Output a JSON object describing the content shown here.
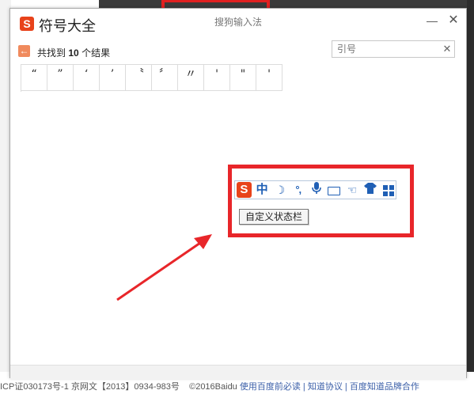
{
  "app": {
    "logo_text": "S",
    "title": "符号大全",
    "window_title": "搜狗输入法",
    "minimize": "—",
    "close": "✕"
  },
  "results": {
    "back_icon": "←",
    "prefix": "共找到",
    "count": "10",
    "suffix": "个结果"
  },
  "search": {
    "placeholder": "引号",
    "clear": "✕"
  },
  "symbols": [
    "“",
    "”",
    "‘",
    "’",
    "〝",
    "〞",
    "〃",
    "'",
    "\"",
    "'"
  ],
  "status_bar": {
    "logo_text": "S",
    "lang": "中",
    "moon_icon": "☽",
    "punct": "°,",
    "mic_icon": "🎤",
    "keyboard_icon": "keyboard-icon",
    "hand_icon": "☜",
    "skin_icon": "👕",
    "toolbox_icon": "grid-icon"
  },
  "custom_button": "自定义状态栏",
  "footer": {
    "icp": "ICP证030173号-1",
    "net": "京网文【2013】0934-983号",
    "copyright": "©2016Baidu",
    "link1": "使用百度前必读",
    "link2": "知道协议",
    "link3": "百度知道品牌合作"
  },
  "colors": {
    "accent_red": "#e8262a",
    "sogou_orange": "#e8431b",
    "icon_blue": "#1f5fb5"
  }
}
